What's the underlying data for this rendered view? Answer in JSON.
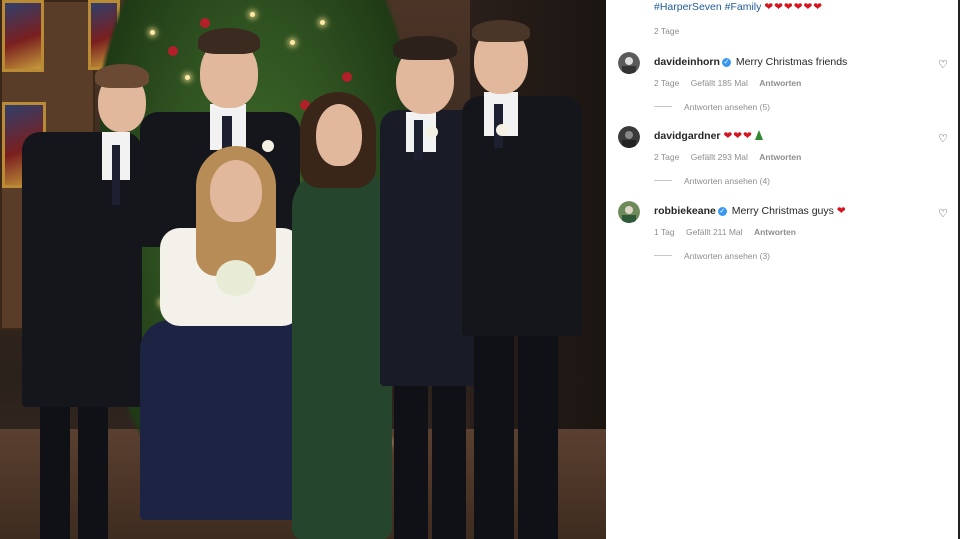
{
  "caption": {
    "hashtags": "#HarperSeven #Family",
    "hearts": "❤❤❤❤❤❤",
    "time": "2 Tage"
  },
  "comments": [
    {
      "user": "davideinhorn",
      "verified": true,
      "text": "Merry Christmas friends",
      "emoji": "",
      "time": "2 Tage",
      "likes": "Gefällt 185 Mal",
      "reply": "Antworten",
      "view_replies": "Antworten ansehen (5)",
      "avatar_color": "#5b5b5b"
    },
    {
      "user": "davidgardner",
      "verified": false,
      "text": "",
      "emoji": "❤❤❤",
      "time": "2 Tage",
      "likes": "Gefällt 293 Mal",
      "reply": "Antworten",
      "view_replies": "Antworten ansehen (4)",
      "avatar_color": "#3a3a3a"
    },
    {
      "user": "robbiekeane",
      "verified": true,
      "text": "Merry Christmas guys",
      "emoji": "❤",
      "time": "1 Tag",
      "likes": "Gefällt 211 Mal",
      "reply": "Antworten",
      "view_replies": "Antworten ansehen (3)",
      "avatar_color": "#6f8a5a"
    }
  ],
  "icons": {
    "like": "heart-outline-icon",
    "verified": "verified-badge-icon",
    "tree": "christmas-tree-emoji"
  },
  "colors": {
    "hashtag": "#1f5a9a",
    "meta_gray": "#8e8e8e",
    "verified_blue": "#3897f0",
    "heart_red": "#d4151f"
  }
}
